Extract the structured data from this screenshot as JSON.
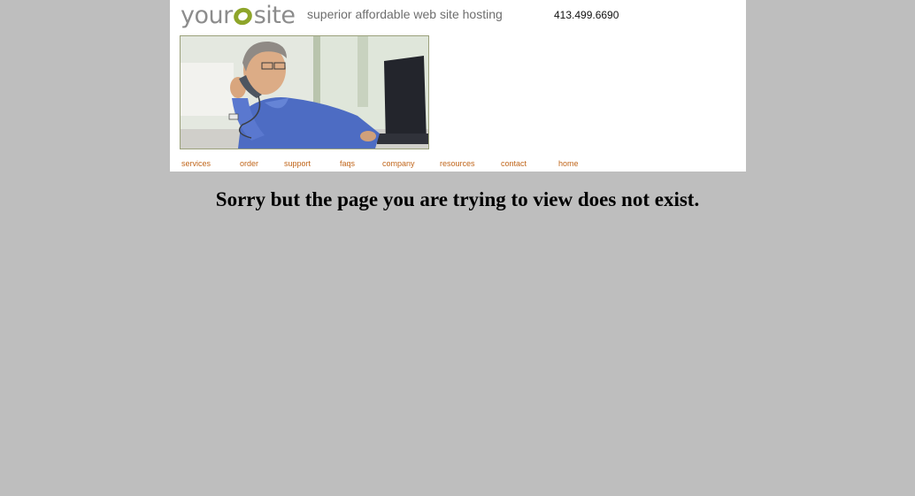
{
  "header": {
    "logo_left": "your",
    "logo_right": "site",
    "tagline": "superior affordable web site hosting",
    "phone": "413.499.6690"
  },
  "nav": [
    {
      "label": "services"
    },
    {
      "label": "order"
    },
    {
      "label": "support"
    },
    {
      "label": "faqs"
    },
    {
      "label": "company"
    },
    {
      "label": "resources"
    },
    {
      "label": "contact"
    },
    {
      "label": "home"
    }
  ],
  "main": {
    "error_message": "Sorry but the page you are trying to view does not exist."
  },
  "colors": {
    "background": "#bebebe",
    "nav_link": "#c0651a",
    "logo_accent": "#8ea52a"
  }
}
